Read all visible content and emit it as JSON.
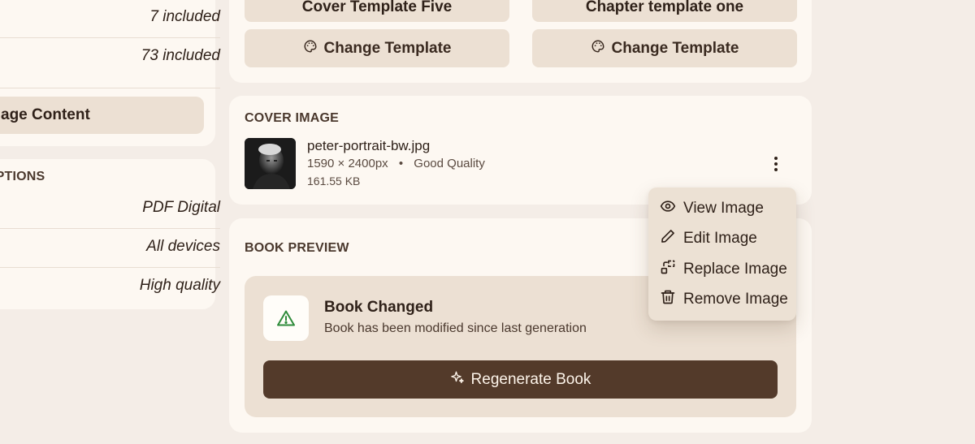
{
  "left_panel": {
    "included_rows": [
      "7 included",
      "73 included"
    ],
    "manage_button": "Manage Content",
    "options_label": "OPTIONS",
    "option_rows": [
      "PDF Digital",
      "All devices",
      "High quality"
    ]
  },
  "templates": {
    "cover_name": "Cover Template Five",
    "chapter_name": "Chapter template one",
    "change_label": "Change Template"
  },
  "cover_image": {
    "section_label": "COVER IMAGE",
    "file_name": "peter-portrait-bw.jpg",
    "dimensions": "1590 × 2400px",
    "quality": "Good Quality",
    "file_size": "161.55 KB"
  },
  "image_menu": {
    "items": [
      "View Image",
      "Edit Image",
      "Replace Image",
      "Remove Image"
    ]
  },
  "book_preview": {
    "section_label": "BOOK PREVIEW",
    "status_title": "Book Changed",
    "status_message": "Book has been modified since last generation",
    "regenerate_label": "Regenerate Book"
  },
  "colors": {
    "page_bg": "#f4ede7",
    "card_bg": "#fdf8f2",
    "accent_tan": "#ece0d3",
    "primary_brown": "#533a2a",
    "warning_green": "#2e8b3a"
  },
  "icons": {
    "change_template": "palette-icon",
    "menu": "more-vertical-icon",
    "view": "eye-icon",
    "edit": "pencil-icon",
    "replace": "replace-icon",
    "remove": "trash-icon",
    "warning": "alert-triangle-icon",
    "regenerate": "sparkle-icon"
  }
}
